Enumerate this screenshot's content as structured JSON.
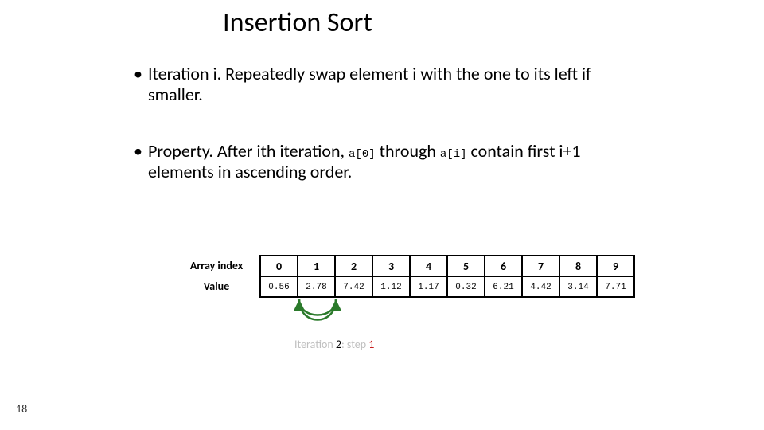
{
  "title": "Insertion Sort",
  "bullets": {
    "b1_prefix": "Iteration i.  Repeatedly swap element i with the one to its left if smaller.",
    "b2_p1": "Property.  After ith iteration, ",
    "b2_code1": "a[0]",
    "b2_p2": " through ",
    "b2_code2": "a[i]",
    "b2_p3": " contain first i+1 elements in ascending order."
  },
  "table": {
    "row1_label": "Array index",
    "row2_label": "Value",
    "indices": [
      "0",
      "1",
      "2",
      "3",
      "4",
      "5",
      "6",
      "7",
      "8",
      "9"
    ],
    "values": [
      "0.56",
      "2.78",
      "7.42",
      "1.12",
      "1.17",
      "0.32",
      "6.21",
      "4.42",
      "3.14",
      "7.71"
    ]
  },
  "caption": {
    "t1": "Iteration ",
    "num": "2",
    "t2": ":  step ",
    "step": "1"
  },
  "footer": {
    "page": "18"
  },
  "chart_data": {
    "type": "table",
    "description": "Insertion sort state before iteration 2 step 1 swap",
    "columns": [
      "index",
      "value",
      "state"
    ],
    "rows": [
      {
        "index": 0,
        "value": 0.56,
        "state": "sorted-dimmed"
      },
      {
        "index": 1,
        "value": 2.78,
        "state": "sorted-dimmed"
      },
      {
        "index": 2,
        "value": 7.42,
        "state": "current"
      },
      {
        "index": 3,
        "value": 1.12,
        "state": "unsorted"
      },
      {
        "index": 4,
        "value": 1.17,
        "state": "unsorted"
      },
      {
        "index": 5,
        "value": 0.32,
        "state": "unsorted"
      },
      {
        "index": 6,
        "value": 6.21,
        "state": "unsorted"
      },
      {
        "index": 7,
        "value": 4.42,
        "state": "unsorted"
      },
      {
        "index": 8,
        "value": 3.14,
        "state": "unsorted"
      },
      {
        "index": 9,
        "value": 7.71,
        "state": "unsorted"
      }
    ],
    "swap_arrow": {
      "from_index": 2,
      "to_index": 1
    },
    "iteration": 2,
    "step": 1
  }
}
